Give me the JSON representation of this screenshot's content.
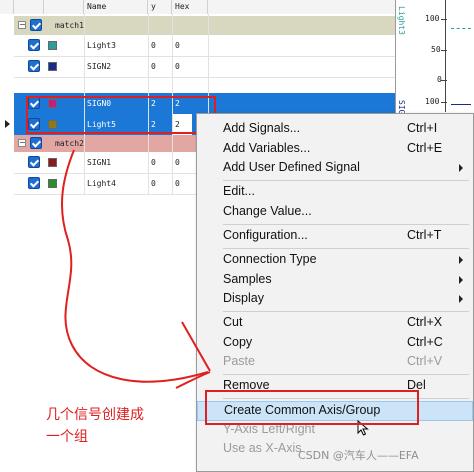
{
  "table": {
    "columns": [
      "Name",
      "y",
      "Hex"
    ],
    "groups": [
      {
        "name": "match1",
        "color": "#d8d8c0"
      },
      {
        "name": "match2",
        "color": "#e3a7a3"
      }
    ],
    "rows": [
      {
        "name": "Light3",
        "y": "0",
        "hex": "0",
        "swatch": "#2a9d9d",
        "selected": false
      },
      {
        "name": "SIGN2",
        "y": "0",
        "hex": "0",
        "swatch": "#1a2a8c",
        "selected": false
      },
      {
        "name": "SIGN0",
        "y": "2",
        "hex": "2",
        "swatch": "#c01f7f",
        "selected": true
      },
      {
        "name": "Light5",
        "y": "2",
        "hex": "2",
        "swatch": "#8a7a1a",
        "selected": true
      },
      {
        "name": "SIGN1",
        "y": "0",
        "hex": "0",
        "swatch": "#8c1a1a",
        "selected": false
      },
      {
        "name": "Light4",
        "y": "0",
        "hex": "0",
        "swatch": "#2a8c2a",
        "selected": false
      }
    ],
    "selection_color": "#1c78d6"
  },
  "wave": {
    "label_top": "Light3",
    "label_mid": "SIGN2",
    "ticks": [
      "100",
      "50",
      "0",
      "100",
      "0"
    ]
  },
  "menu": {
    "items": [
      {
        "label": "Add Signals...",
        "shortcut": "Ctrl+I"
      },
      {
        "label": "Add Variables...",
        "shortcut": "Ctrl+E"
      },
      {
        "label": "Add User Defined Signal",
        "arrow": true
      },
      {
        "label": "Edit..."
      },
      {
        "label": "Change Value..."
      },
      {
        "label": "Configuration...",
        "shortcut": "Ctrl+T"
      },
      {
        "label": "Connection Type",
        "arrow": true
      },
      {
        "label": "Samples",
        "arrow": true
      },
      {
        "label": "Display",
        "arrow": true
      },
      {
        "label": "Cut",
        "shortcut": "Ctrl+X"
      },
      {
        "label": "Copy",
        "shortcut": "Ctrl+C"
      },
      {
        "label": "Paste",
        "shortcut": "Ctrl+V",
        "disabled": true
      },
      {
        "label": "Remove",
        "shortcut": "Del"
      },
      {
        "label": "Create Common Axis/Group",
        "highlighted": true
      },
      {
        "label": "Y-Axis Left/Right",
        "disabled": true
      },
      {
        "label": "Use as X-Axis",
        "disabled": true
      }
    ]
  },
  "annotation": {
    "line1": "几个信号创建成",
    "line2": "一个组",
    "color": "#e02020"
  },
  "watermark": "CSDN @汽车人——EFA"
}
